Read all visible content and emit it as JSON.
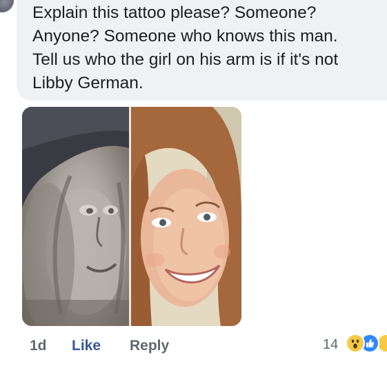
{
  "comment": {
    "text": "Explain this tattoo please? Someone?\nAnyone? Someone who knows this man.\nTell us who the girl on his arm is if it's not\nLibby German."
  },
  "actions": {
    "timestamp": "1d",
    "like_label": "Like",
    "reply_label": "Reply"
  },
  "reactions": {
    "count": "14",
    "icons": [
      "wow-icon",
      "like-icon",
      "wow-icon"
    ]
  },
  "colors": {
    "bubble_background": "#eff1f4",
    "text": "#1c1e21",
    "like_blue": "#385898",
    "meta_gray": "#606770"
  }
}
